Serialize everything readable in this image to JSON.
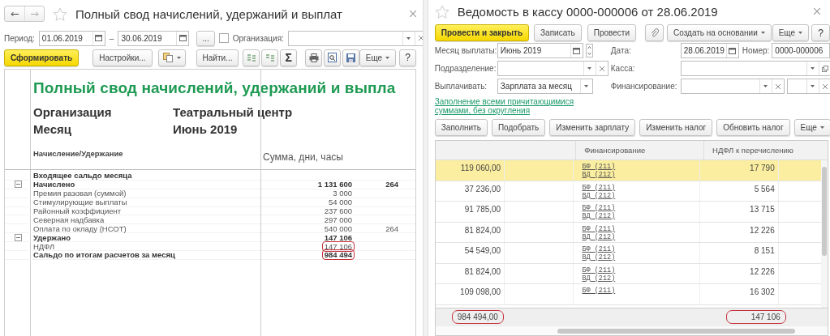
{
  "report_window": {
    "title": "Полный свод начислений, удержаний и выплат",
    "period_label": "Период:",
    "date_from": "01.06.2019",
    "dash": "–",
    "date_to": "30.06.2019",
    "choose_button": "...",
    "organization": {
      "label": "Организация:",
      "checked": false
    },
    "toolbar": {
      "generate": "Сформировать",
      "settings": "Настройки...",
      "find": "Найти...",
      "sum": "Σ",
      "more": "Еще",
      "help": "?"
    },
    "report": {
      "heading": "Полный свод начислений, удержаний и выпла",
      "details": [
        {
          "label": "Организация",
          "value": "Театральный центр"
        },
        {
          "label": "Месяц",
          "value": "Июнь 2019"
        }
      ],
      "columns": [
        "Начисление/Удержание",
        "Сумма, дни, часы"
      ],
      "rows": [
        {
          "kind": "group",
          "name": "Входящее сальдо месяца",
          "circled": false
        },
        {
          "kind": "group",
          "name": "Начислено",
          "sum": "1 131 600",
          "hours": "264",
          "circled": false,
          "expanded": true,
          "children": [
            {
              "kind": "item",
              "name": "Премия разовая (суммой)",
              "sum": "3 000",
              "circled": false
            },
            {
              "kind": "item",
              "name": "Стимулирующие выплаты",
              "sum": "54 000",
              "circled": false
            },
            {
              "kind": "item",
              "name": "Районный коэффициент",
              "sum": "237 600",
              "circled": false
            },
            {
              "kind": "item",
              "name": "Северная надбавка",
              "sum": "297 000",
              "circled": false
            },
            {
              "kind": "item",
              "name": "Оплата по окладу (НСОТ)",
              "sum": "540 000",
              "hours": "264",
              "circled": false
            }
          ]
        },
        {
          "kind": "group",
          "name": "Удержано",
          "sum": "147 106",
          "circled": false,
          "expanded": true,
          "children": [
            {
              "kind": "item",
              "name": "НДФЛ",
              "sum": "147 106",
              "circled": true
            }
          ]
        },
        {
          "kind": "group",
          "name": "Сальдо по итогам расчетов за месяц",
          "sum": "984 494",
          "circled": true
        }
      ]
    }
  },
  "doc_window": {
    "title": "Ведомость в кассу 0000-000006 от 28.06.2019",
    "toolbar": {
      "post_and_close": "Провести и закрыть",
      "save": "Записать",
      "post": "Провести",
      "create_based_on": "Создать на основании",
      "more": "Еще",
      "help": "?"
    },
    "pay_month": {
      "label": "Месяц выплаты:",
      "value": "Июнь 2019"
    },
    "date": {
      "label": "Дата:",
      "value": "28.06.2019"
    },
    "number": {
      "label": "Номер:",
      "value": "0000-000006"
    },
    "department": {
      "label": "Подразделение:"
    },
    "cash_desk": {
      "label": "Касса:"
    },
    "pay_type": {
      "label": "Выплачивать:",
      "value": "Зарплата за месяц"
    },
    "financing": {
      "label": "Финансирование:"
    },
    "fill_link": "Заполнение всеми причитающимися суммами, без округления",
    "table_toolbar": [
      "Заполнить",
      "Подобрать",
      "Изменить зарплату",
      "Изменить налог",
      "Обновить налог"
    ],
    "table_more": "Еще",
    "table": {
      "columns": [
        "Финансирование",
        "НДФЛ к перечислению"
      ],
      "rows": [
        {
          "column_1": "119 060,00",
          "financing": [
            "БФ (211)",
            "ВД (212)"
          ],
          "ndfl": "17 790",
          "selected": true
        },
        {
          "column_1": "37 236,00",
          "financing": [
            "БФ (211)",
            "ВД (212)"
          ],
          "ndfl": "5 564",
          "selected": false
        },
        {
          "column_1": "91 785,00",
          "financing": [
            "БФ (211)",
            "ВД (212)"
          ],
          "ndfl": "13 715",
          "selected": false
        },
        {
          "column_1": "81 824,00",
          "financing": [
            "БФ (211)",
            "ВД (212)"
          ],
          "ndfl": "12 226",
          "selected": false
        },
        {
          "column_1": "54 549,00",
          "financing": [
            "БФ (211)",
            "ВД (212)"
          ],
          "ndfl": "8 151",
          "selected": false
        },
        {
          "column_1": "81 824,00",
          "financing": [
            "БФ (211)",
            "ВД (212)"
          ],
          "ndfl": "12 226",
          "selected": false
        },
        {
          "column_1": "109 098,00",
          "financing": [
            "БФ (211)"
          ],
          "ndfl": "16 302",
          "selected": false
        }
      ],
      "totals": {
        "column_1": "984 494,00",
        "ndfl": "147 106",
        "circled": true
      }
    }
  }
}
